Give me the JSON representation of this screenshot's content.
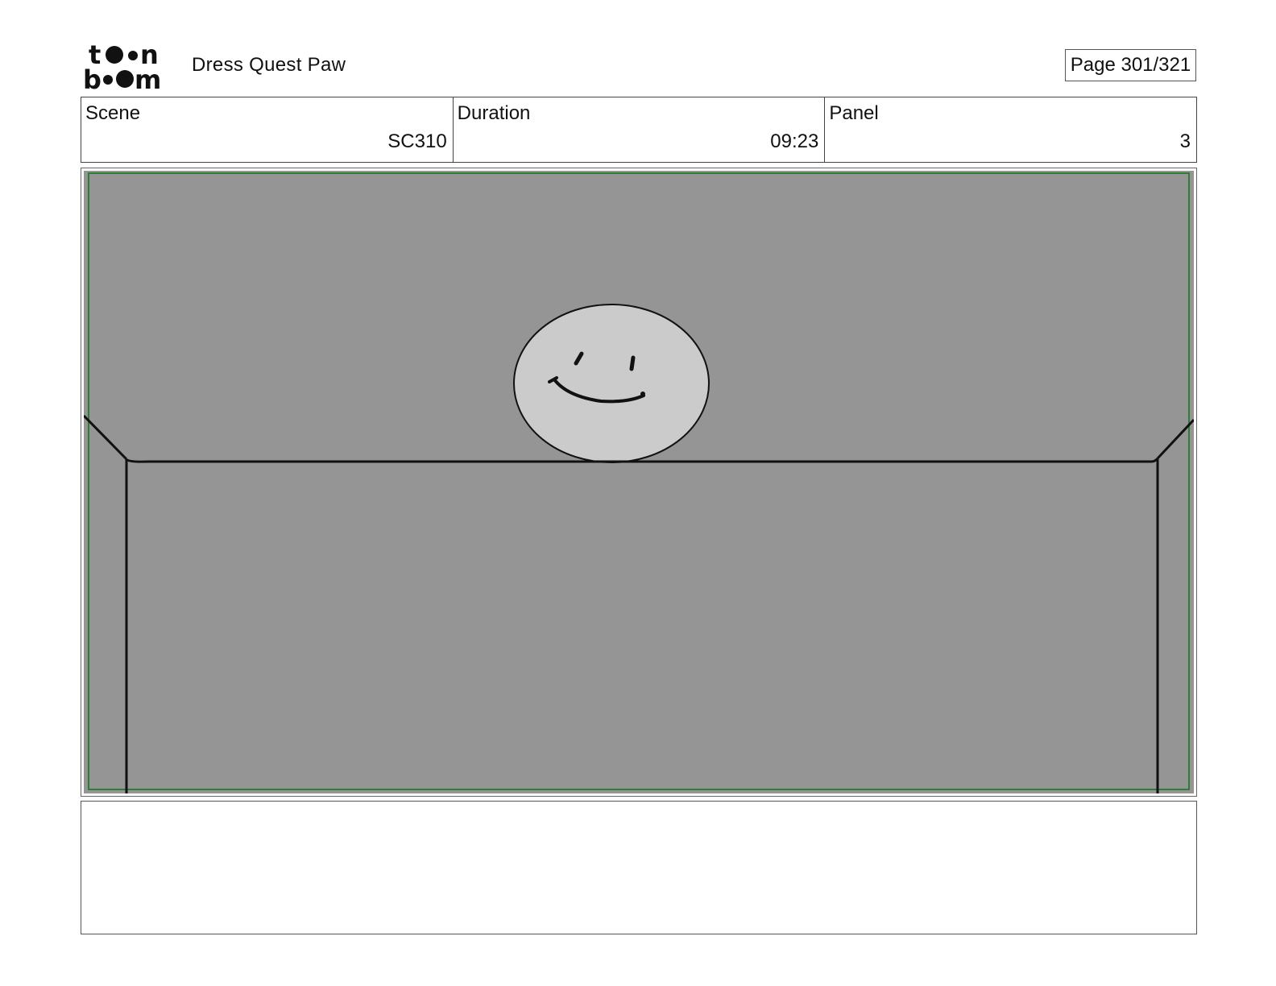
{
  "header": {
    "logo_text": "toonboom",
    "project_title": "Dress Quest Paw",
    "page_label": "Page 301/321"
  },
  "info": {
    "scene_label": "Scene",
    "scene_value": "SC310",
    "duration_label": "Duration",
    "duration_value": "09:23",
    "panel_label": "Panel",
    "panel_value": "3"
  },
  "panel": {
    "drawing": "smiley-face-behind-wall-sketch",
    "background_color": "#959595",
    "face_color": "#cbcbcb",
    "safe_area_color": "#2e7d32"
  },
  "notes": {
    "text": ""
  }
}
